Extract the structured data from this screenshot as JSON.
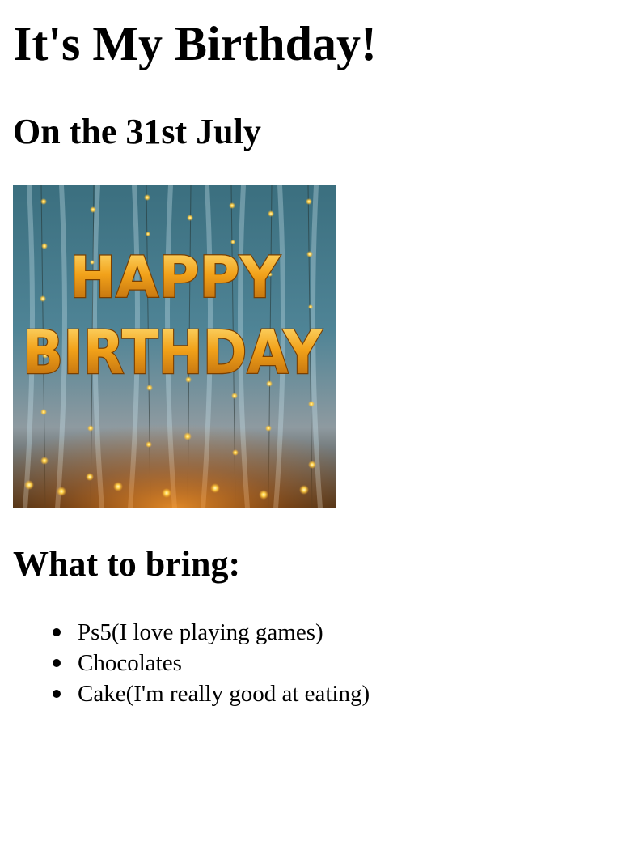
{
  "heading": "It's My Birthday!",
  "subheading": "On the 31st July",
  "photo": {
    "banner_line1": "HAPPY",
    "banner_line2": "BIRTHDAY"
  },
  "bring_heading": "What to bring:",
  "bring_items": [
    "Ps5(I love playing games)",
    "Chocolates",
    "Cake(I'm really good at eating)"
  ]
}
